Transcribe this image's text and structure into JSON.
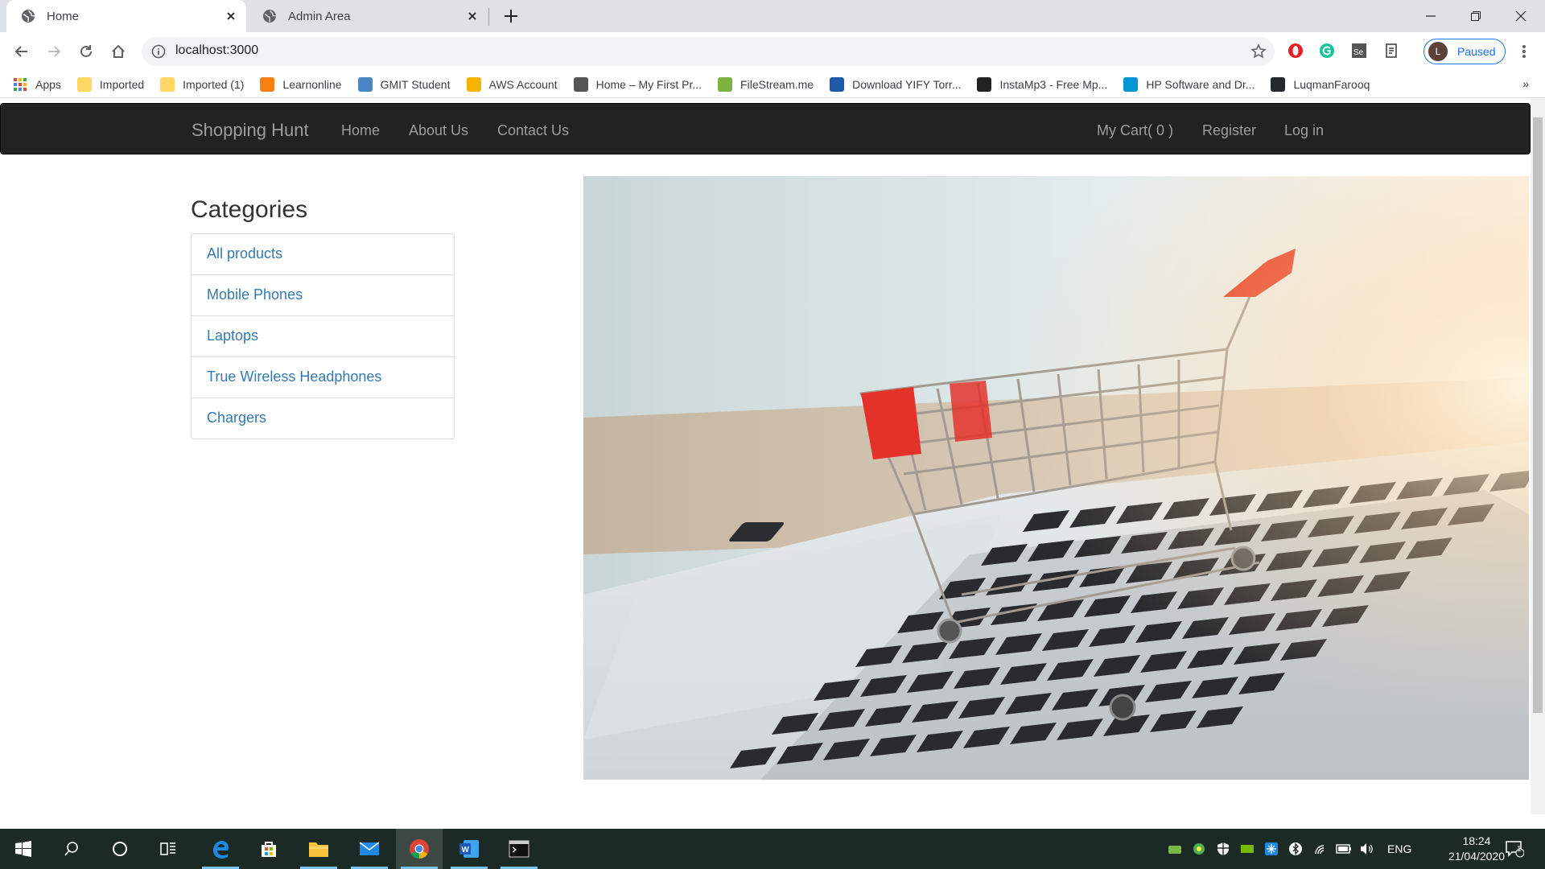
{
  "browser": {
    "tabs": [
      {
        "title": "Home",
        "active": true,
        "icon": "globe-icon"
      },
      {
        "title": "Admin Area",
        "active": false,
        "icon": "globe-icon"
      }
    ],
    "url": "localhost:3000",
    "profile": {
      "initial": "L",
      "status": "Paused"
    },
    "bookmarks": [
      {
        "label": "Apps",
        "icon": "apps-grid-icon",
        "color": "#ea4335"
      },
      {
        "label": "Imported",
        "icon": "folder-icon",
        "color": "#fdd663"
      },
      {
        "label": "Imported (1)",
        "icon": "folder-icon",
        "color": "#fdd663"
      },
      {
        "label": "Learnonline",
        "icon": "moodle-icon",
        "color": "#f98012"
      },
      {
        "label": "GMIT Student",
        "icon": "gmit-icon",
        "color": "#4a86c5"
      },
      {
        "label": "AWS Account",
        "icon": "aws-icon",
        "color": "#f4b400"
      },
      {
        "label": "Home – My First Pr...",
        "icon": "wordpress-icon",
        "color": "#555555"
      },
      {
        "label": "FileStream.me",
        "icon": "filestream-icon",
        "color": "#7cb342"
      },
      {
        "label": "Download YIFY Torr...",
        "icon": "film-icon",
        "color": "#1e5aa8"
      },
      {
        "label": "InstaMp3 - Free Mp...",
        "icon": "radio-icon",
        "color": "#222222"
      },
      {
        "label": "HP Software and Dr...",
        "icon": "hp-icon",
        "color": "#0096d6"
      },
      {
        "label": "LuqmanFarooq",
        "icon": "github-icon",
        "color": "#24292e"
      }
    ],
    "bookmarks_more": "»"
  },
  "site": {
    "brand": "Shopping Hunt",
    "nav_left": [
      "Home",
      "About Us",
      "Contact Us"
    ],
    "nav_right": [
      "My Cart( 0 )",
      "Register",
      "Log in"
    ],
    "categories_title": "Categories",
    "categories": [
      "All products",
      "Mobile Phones",
      "Laptops",
      "True Wireless Headphones",
      "Chargers"
    ],
    "hero_image": "shopping-cart-on-laptop-keyboard"
  },
  "taskbar": {
    "apps": [
      "start-icon",
      "search-icon",
      "cortana-icon",
      "task-view-icon",
      "edge-icon",
      "store-icon",
      "file-explorer-icon",
      "mail-icon",
      "chrome-icon",
      "word-icon",
      "terminal-icon"
    ],
    "lang": "ENG",
    "time": "18:24",
    "date": "21/04/2020",
    "notifications": "1"
  },
  "colors": {
    "navbar_bg": "#222222",
    "nav_link": "#9d9d9d",
    "link_blue": "#337ab7",
    "taskbar_bg": "#1c2a25"
  }
}
